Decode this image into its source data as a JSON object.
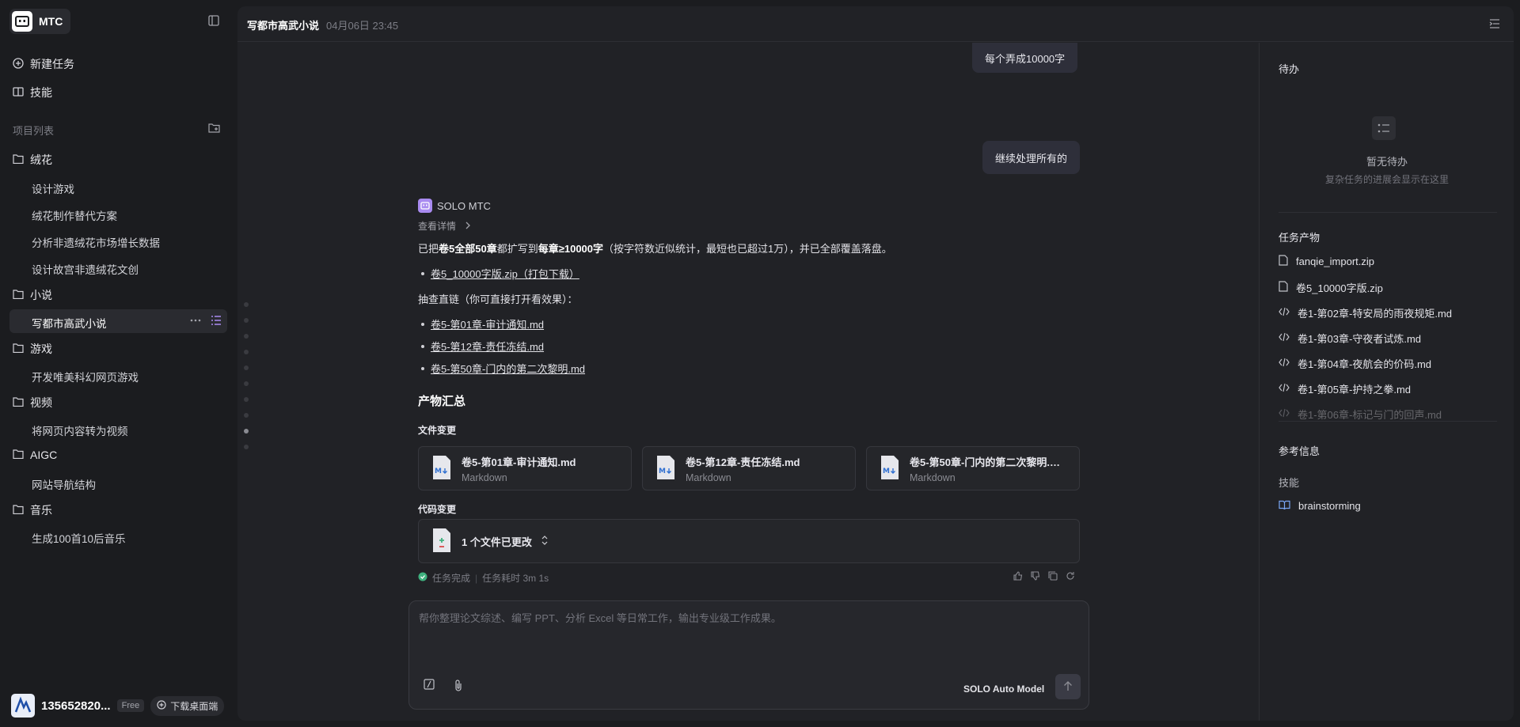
{
  "brand": {
    "name": "MTC"
  },
  "nav": {
    "new_task": "新建任务",
    "skills": "技能"
  },
  "projects": {
    "title": "项目列表",
    "folders": [
      {
        "name": "绒花",
        "children": [
          "设计游戏",
          "绒花制作替代方案",
          "分析非遗绒花市场增长数据",
          "设计故宫非遗绒花文创"
        ]
      },
      {
        "name": "小说",
        "children": [
          "写都市高武小说"
        ]
      },
      {
        "name": "游戏",
        "children": [
          "开发唯美科幻网页游戏"
        ]
      },
      {
        "name": "视频",
        "children": [
          "将网页内容转为视频"
        ]
      },
      {
        "name": "AIGC",
        "children": [
          "网站导航结构"
        ]
      },
      {
        "name": "音乐",
        "children": [
          "生成100首10后音乐"
        ]
      }
    ]
  },
  "user": {
    "name": "135652820...",
    "plan": "Free",
    "download": "下载桌面端"
  },
  "header": {
    "title": "写都市高武小说",
    "time": "04月06日 23:45"
  },
  "chat": {
    "user_messages": [
      "每个弄成10000字",
      "继续处理所有的"
    ],
    "agent_name": "SOLO MTC",
    "detail_link": "查看详情",
    "summary_pre": "已把",
    "summary_b1": "卷5全部50章",
    "summary_mid": "都扩写到",
    "summary_b2": "每章≥10000字",
    "summary_post": "（按字符数近似统计，最短也已超过1万），并已全部覆盖落盘。",
    "download_link": "卷5_10000字版.zip（打包下载）",
    "spot_check": "抽查直链（你可直接打开看效果）：",
    "links": [
      "卷5-第01章-审计通知.md",
      "卷5-第12章-责任冻结.md",
      "卷5-第50章-门内的第二次黎明.md"
    ],
    "summary_title": "产物汇总",
    "file_changes_title": "文件变更",
    "files": [
      {
        "name": "卷5-第01章-审计通知.md",
        "type": "Markdown"
      },
      {
        "name": "卷5-第12章-责任冻结.md",
        "type": "Markdown"
      },
      {
        "name": "卷5-第50章-门内的第二次黎明.md",
        "type": "Markdown"
      }
    ],
    "code_changes_title": "代码变更",
    "code_changes_summary": "1 个文件已更改",
    "status_done": "任务完成",
    "status_time": "任务耗时 3m 1s"
  },
  "composer": {
    "placeholder": "帮你整理论文综述、编写 PPT、分析 Excel 等日常工作，输出专业级工作成果。",
    "model": "SOLO Auto Model"
  },
  "right_panel": {
    "todo_title": "待办",
    "todo_empty": "暂无待办",
    "todo_empty_sub": "复杂任务的进展会显示在这里",
    "artifacts_title": "任务产物",
    "artifacts": [
      {
        "name": "fanqie_import.zip",
        "icon": "file-icon"
      },
      {
        "name": "卷5_10000字版.zip",
        "icon": "file-icon"
      },
      {
        "name": "卷1-第02章-特安局的雨夜规矩.md",
        "icon": "code-icon"
      },
      {
        "name": "卷1-第03章-守夜者试炼.md",
        "icon": "code-icon"
      },
      {
        "name": "卷1-第04章-夜航会的价码.md",
        "icon": "code-icon"
      },
      {
        "name": "卷1-第05章-护持之拳.md",
        "icon": "code-icon"
      },
      {
        "name": "卷1-第06章-标记与门的回声.md",
        "icon": "code-icon"
      }
    ],
    "ref_title": "参考信息",
    "skills_title": "技能",
    "skill": "brainstorming"
  },
  "colors": {
    "accent": "#a98bf0",
    "background": "#1b1c1f",
    "panel": "#212226",
    "success": "#3fb27f"
  }
}
